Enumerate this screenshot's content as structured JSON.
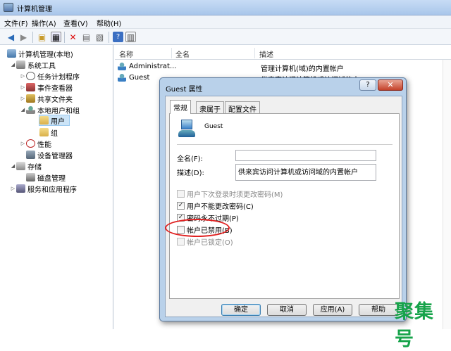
{
  "window": {
    "title": "计算机管理"
  },
  "menu": [
    "文件(F)",
    "操作(A)",
    "查看(V)",
    "帮助(H)"
  ],
  "toolbar_icons": [
    "back-arrow-icon",
    "forward-arrow-icon",
    "up-folder-icon",
    "show-tree-icon",
    "delete-icon",
    "properties-icon",
    "export-icon",
    "help-icon",
    "view-icon"
  ],
  "tree": {
    "root": "计算机管理(本地)",
    "system_tools": "系统工具",
    "task_scheduler": "任务计划程序",
    "event_viewer": "事件查看器",
    "shared_folders": "共享文件夹",
    "local_users": "本地用户和组",
    "users": "用户",
    "groups": "组",
    "performance": "性能",
    "device_manager": "设备管理器",
    "storage": "存储",
    "disk_management": "磁盘管理",
    "services": "服务和应用程序"
  },
  "list": {
    "columns": [
      "名称",
      "全名",
      "描述"
    ],
    "rows": [
      {
        "name": "Administrat...",
        "fullname": "",
        "desc": "管理计算机(域)的内置帐户"
      },
      {
        "name": "Guest",
        "fullname": "",
        "desc": "供来宾访问计算机或访问域的内..."
      }
    ]
  },
  "dialog": {
    "title": "Guest 属性",
    "help": "?",
    "close": "✕",
    "tabs": [
      "常规",
      "隶属于",
      "配置文件"
    ],
    "username": "Guest",
    "fullname_label": "全名(F):",
    "fullname_value": "",
    "desc_label": "描述(D):",
    "desc_value": "供来宾访问计算机或访问域的内置帐户",
    "checkboxes": [
      {
        "label": "用户下次登录时须更改密码(M)",
        "checked": false,
        "disabled": true
      },
      {
        "label": "用户不能更改密码(C)",
        "checked": true,
        "disabled": false
      },
      {
        "label": "密码永不过期(P)",
        "checked": true,
        "disabled": false
      },
      {
        "label": "帐户已禁用(B)",
        "checked": false,
        "disabled": false
      },
      {
        "label": "帐户已锁定(O)",
        "checked": false,
        "disabled": true
      }
    ],
    "buttons": {
      "ok": "确定",
      "cancel": "取消",
      "apply": "应用(A)",
      "help": "帮助"
    }
  },
  "watermark": "聚集号",
  "colors": {
    "accent": "#b9d1ea",
    "annotation": "#e02020",
    "watermark": "#16a34a"
  }
}
